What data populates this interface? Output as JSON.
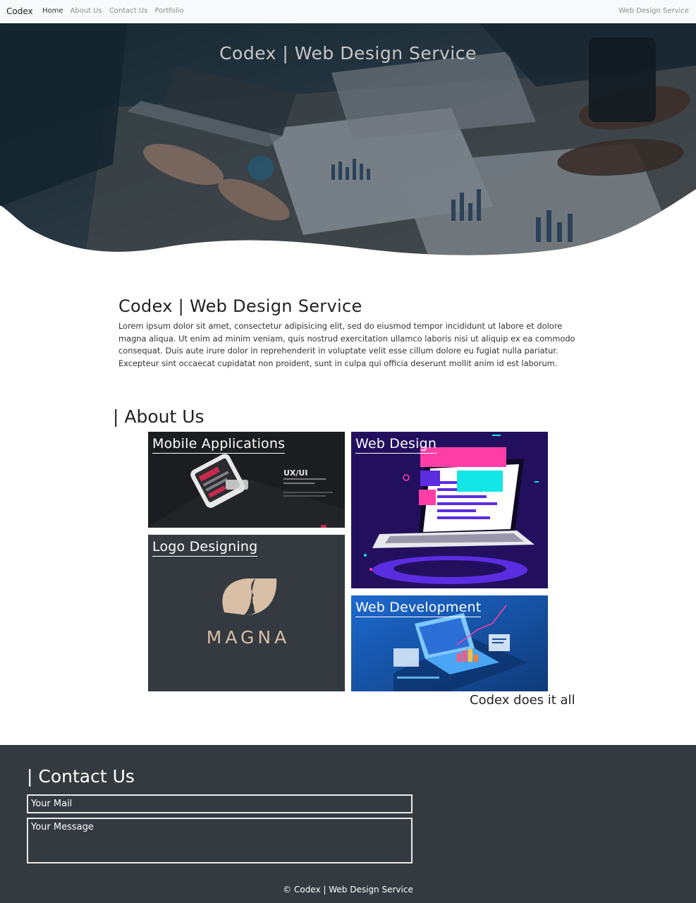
{
  "nav": {
    "brand": "Codex",
    "links": [
      {
        "label": "Home"
      },
      {
        "label": "About Us"
      },
      {
        "label": "Contact Us"
      },
      {
        "label": "Portfolio"
      }
    ],
    "right_text": "Web Design Service"
  },
  "hero": {
    "title": "Codex | Web Design Service"
  },
  "intro": {
    "heading": "Codex | Web Design Service",
    "body": "Lorem ipsum dolor sit amet, consectetur adipisicing elit, sed do eiusmod tempor incididunt ut labore et dolore magna aliqua. Ut enim ad minim veniam, quis nostrud exercitation ullamco laboris nisi ut aliquip ex ea commodo consequat. Duis aute irure dolor in reprehenderit in voluptate velit esse cillum dolore eu fugiat nulla pariatur. Excepteur sint occaecat cupidatat non proident, sunt in culpa qui officia deserunt mollit anim id est laborum."
  },
  "about": {
    "heading": "| About Us",
    "cards": [
      {
        "title": "Mobile Applications",
        "image_text": "UX/UI"
      },
      {
        "title": "Web Design"
      },
      {
        "title": "Logo Designing",
        "logo_text": "MAGNA"
      },
      {
        "title": "Web Development"
      }
    ],
    "tagline": "Codex does it all"
  },
  "contact": {
    "heading": "| Contact Us",
    "mail_placeholder": "Your Mail",
    "message_placeholder": "Your Message",
    "copyright": "© Codex | Web Design Service"
  },
  "colors": {
    "nav_bg": "#f8f9fa",
    "footer_bg": "#343a40",
    "logo_card_bg": "#343a40",
    "web_design_bg": "#22105e",
    "web_dev_bg": "#1a4f96"
  }
}
